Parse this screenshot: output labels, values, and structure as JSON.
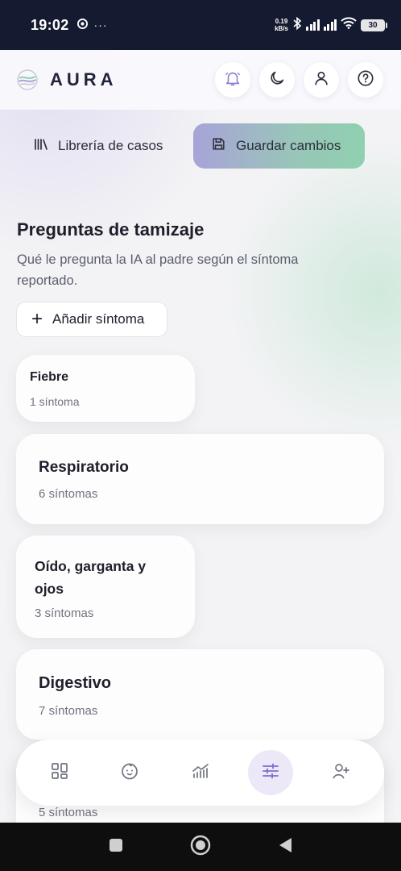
{
  "status_bar": {
    "time": "19:02",
    "net_speed_value": "0.19",
    "net_speed_unit": "kB/s",
    "battery": "30",
    "icons": [
      "chrome-icon",
      "more-dots-icon",
      "bluetooth-icon",
      "signal-icon",
      "signal-icon",
      "wifi-icon",
      "battery-icon"
    ]
  },
  "header": {
    "brand": "AURA",
    "actions": [
      "bell-icon",
      "moon-icon",
      "user-icon",
      "help-icon"
    ]
  },
  "toolbar": {
    "library_label": "Librería de casos",
    "save_label": "Guardar cambios"
  },
  "section": {
    "title": "Preguntas de tamizaje",
    "description": "Qué le pregunta la IA al padre según el síntoma reportado."
  },
  "add_button": {
    "label": "Añadir síntoma"
  },
  "categories": [
    {
      "title": "Fiebre",
      "count": "1 síntoma"
    },
    {
      "title": "Respiratorio",
      "count": "6 síntomas"
    },
    {
      "title": "Oído, garganta y ojos",
      "count": "3 síntomas"
    },
    {
      "title": "Digestivo",
      "count": "7 síntomas"
    },
    {
      "title": "",
      "count": "5 síntomas"
    }
  ],
  "bottom_nav": {
    "items": [
      "dashboard-icon",
      "baby-icon",
      "analytics-icon",
      "sliders-icon",
      "add-user-icon"
    ],
    "active": "sliders-icon"
  },
  "colors": {
    "accent": "#7b6fc9",
    "save_gradient_start": "#a8a3d8",
    "save_gradient_end": "#8fd0b0",
    "background": "#f3f3f5"
  }
}
